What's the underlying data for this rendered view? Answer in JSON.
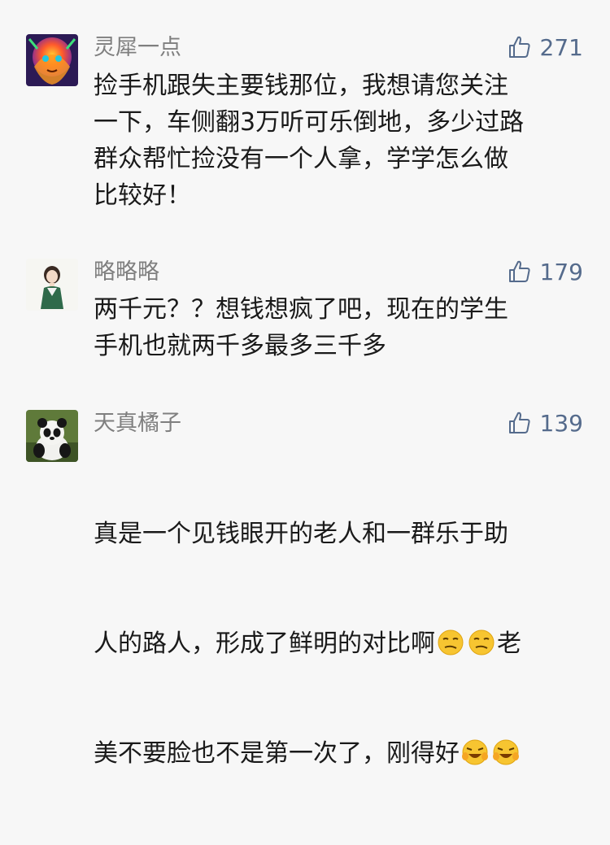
{
  "comments": [
    {
      "username": "灵犀一点",
      "likes": "271",
      "avatar_icon": "colorful-lion-icon",
      "text_lines": [
        "捡手机跟失主要钱那位，我想请您关注",
        "一下，车侧翻3万听可乐倒地，多少过路",
        "群众帮忙捡没有一个人拿，学学怎么做",
        "比较好！"
      ]
    },
    {
      "username": "略略略",
      "likes": "179",
      "avatar_icon": "girl-illustration-icon",
      "text_lines": [
        "两千元？？想钱想疯了吧，现在的学生",
        "手机也就两千多最多三千多"
      ]
    },
    {
      "username": "天真橘子",
      "likes": "139",
      "avatar_icon": "panda-icon",
      "text_line_1": "真是一个见钱眼开的老人和一群乐于助",
      "text_line_2_before": "人的路人，形成了鲜明的对比啊",
      "text_line_2_after": "老",
      "text_line_3": "美不要脸也不是第一次了，刚得好",
      "emoji_1": "smirk-emoji",
      "emoji_2": "laugh-emoji"
    }
  ],
  "colors": {
    "like_blue": "#556b8c",
    "username_gray": "#7f7f7f",
    "background": "#f7f7f7"
  }
}
